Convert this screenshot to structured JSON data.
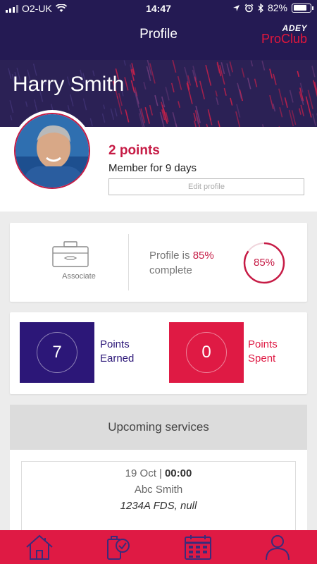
{
  "status_bar": {
    "carrier": "O2-UK",
    "time": "14:47",
    "battery": "82%",
    "battery_level": 0.82
  },
  "header": {
    "title": "Profile",
    "brand_top": "ADEY",
    "brand_bottom": "ProClub"
  },
  "profile": {
    "name": "Harry Smith",
    "points": "2 points",
    "member_since": "Member for 9 days",
    "edit_label": "Edit profile"
  },
  "status": {
    "level_label": "Associate",
    "complete_prefix": "Profile is ",
    "complete_pct": "85%",
    "complete_suffix": "complete",
    "ring_label": "85%",
    "ring_fraction": 0.85
  },
  "points_summary": {
    "earned_value": "7",
    "earned_label_1": "Points",
    "earned_label_2": "Earned",
    "spent_value": "0",
    "spent_label_1": "Points",
    "spent_label_2": "Spent"
  },
  "services": {
    "heading": "Upcoming services",
    "items": [
      {
        "date": "19 Oct",
        "time": "00:00",
        "customer": "Abc Smith",
        "address": "1234A FDS, null"
      }
    ]
  },
  "nav": {
    "items": [
      {
        "icon": "home-icon"
      },
      {
        "icon": "checklist-icon"
      },
      {
        "icon": "calendar-icon"
      },
      {
        "icon": "user-icon"
      }
    ],
    "active_index": 3
  },
  "colors": {
    "header_bg": "#241a53",
    "accent_red": "#df1a44",
    "accent_purple": "#2c1778"
  }
}
